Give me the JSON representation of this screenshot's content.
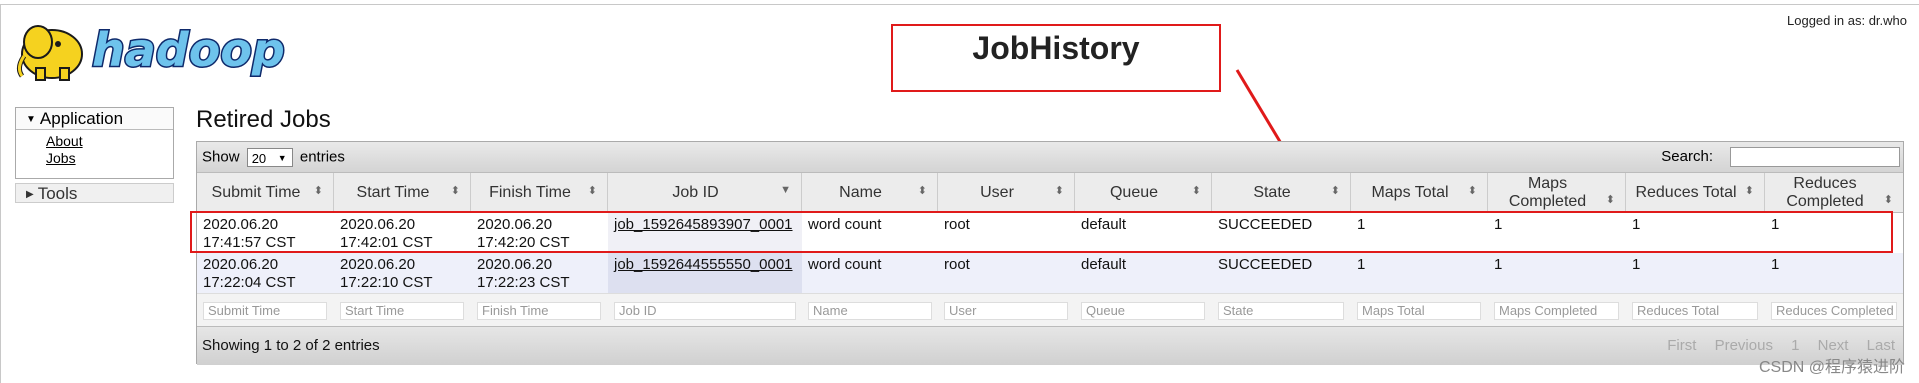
{
  "logo": {
    "text": "hadoop"
  },
  "logged_in": "Logged in as: dr.who",
  "callout": {
    "label": "JobHistory"
  },
  "sidebar": {
    "application": {
      "label": "Application",
      "links": [
        "About",
        "Jobs"
      ]
    },
    "tools": {
      "label": "Tools"
    }
  },
  "page": {
    "title": "Retired Jobs"
  },
  "table": {
    "show_label": "Show",
    "entries_value": "20",
    "entries_label": "entries",
    "search_label": "Search:",
    "columns": [
      "Submit Time",
      "Start Time",
      "Finish Time",
      "Job ID",
      "Name",
      "User",
      "Queue",
      "State",
      "Maps Total",
      "Maps Completed",
      "Reduces Total",
      "Reduces Completed"
    ],
    "rows": [
      {
        "submit_date": "2020.06.20",
        "submit_time": "17:41:57 CST",
        "start_date": "2020.06.20",
        "start_time": "17:42:01 CST",
        "finish_date": "2020.06.20",
        "finish_time": "17:42:20 CST",
        "job_id": "job_1592645893907_0001",
        "name": "word count",
        "user": "root",
        "queue": "default",
        "state": "SUCCEEDED",
        "maps_total": "1",
        "maps_completed": "1",
        "reduces_total": "1",
        "reduces_completed": "1"
      },
      {
        "submit_date": "2020.06.20",
        "submit_time": "17:22:04 CST",
        "start_date": "2020.06.20",
        "start_time": "17:22:10 CST",
        "finish_date": "2020.06.20",
        "finish_time": "17:22:23 CST",
        "job_id": "job_1592644555550_0001",
        "name": "word count",
        "user": "root",
        "queue": "default",
        "state": "SUCCEEDED",
        "maps_total": "1",
        "maps_completed": "1",
        "reduces_total": "1",
        "reduces_completed": "1"
      }
    ],
    "filters": [
      "Submit Time",
      "Start Time",
      "Finish Time",
      "Job ID",
      "Name",
      "User",
      "Queue",
      "State",
      "Maps Total",
      "Maps Completed",
      "Reduces Total",
      "Reduces Completed"
    ],
    "info": "Showing 1 to 2 of 2 entries",
    "pager": {
      "first": "First",
      "previous": "Previous",
      "page": "1",
      "next": "Next",
      "last": "Last"
    }
  },
  "watermark": "CSDN @程序猿进阶"
}
